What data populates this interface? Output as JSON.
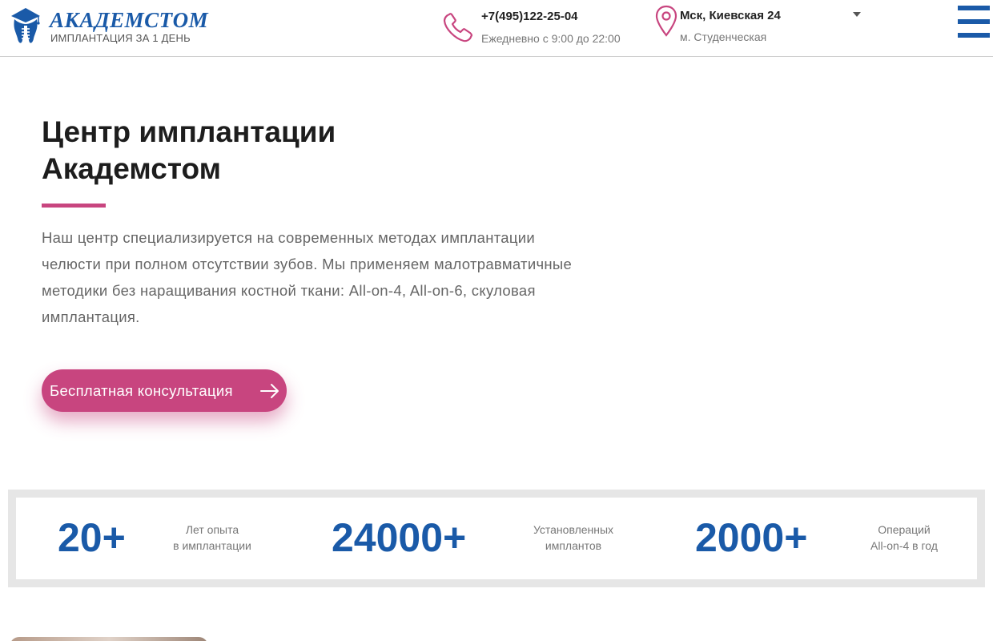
{
  "header": {
    "logo_name": "АКАДЕМСТОМ",
    "logo_tagline": "ИМПЛАНТАЦИЯ ЗА 1 ДЕНЬ",
    "phone": "+7(495)122-25-04",
    "hours": "Ежедневно с 9:00 до 22:00",
    "address": "Мск, Киевская 24",
    "metro": "м. Студенческая",
    "icons": [
      "tooth-logo-icon",
      "phone-icon",
      "map-pin-icon",
      "dropdown-caret-icon",
      "burger-menu-icon"
    ]
  },
  "hero": {
    "title_line1": "Центр имплантации",
    "title_line2": "Академстом",
    "description": "Наш центр специализируется на современных методах имплантации челюсти при полном отсутствии зубов. Мы применяем малотравматичные методики без наращивания костной ткани: All-on-4, All-on-6, скуловая имплантация.",
    "cta_label": "Бесплатная консультация"
  },
  "stats": [
    {
      "value": "20+",
      "label_line1": "Лет опыта",
      "label_line2": "в имплантации"
    },
    {
      "value": "24000+",
      "label_line1": "Установленных",
      "label_line2": "имплантов"
    },
    {
      "value": "2000+",
      "label_line1": "Операций",
      "label_line2": "All-on-4 в год"
    }
  ],
  "colors": {
    "brand_blue": "#1a5aa8",
    "accent_pink": "#c8457f",
    "text_dark": "#1d1d1d",
    "text_gray": "#666666"
  }
}
